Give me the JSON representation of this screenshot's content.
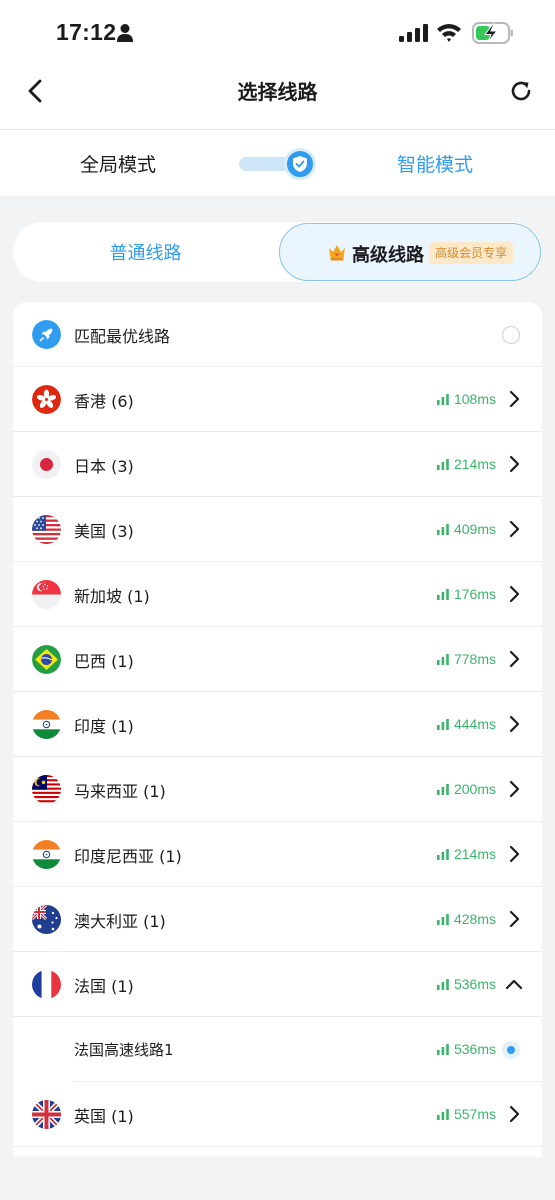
{
  "status_bar": {
    "time": "17:12"
  },
  "nav": {
    "title": "选择线路"
  },
  "mode": {
    "global_label": "全局模式",
    "smart_label": "智能模式",
    "selected": "smart"
  },
  "tabs": {
    "normal_label": "普通线路",
    "premium_label": "高级线路",
    "premium_badge": "高级会员专享",
    "selected": "premium"
  },
  "best_match": {
    "label": "匹配最优线路",
    "selected": false
  },
  "servers": [
    {
      "label": "香港 (6)",
      "latency": "108ms",
      "flag": "hk-flag-icon"
    },
    {
      "label": "日本 (3)",
      "latency": "214ms",
      "flag": "jp-flag-icon"
    },
    {
      "label": "美国 (3)",
      "latency": "409ms",
      "flag": "us-flag-icon"
    },
    {
      "label": "新加坡 (1)",
      "latency": "176ms",
      "flag": "sg-flag-icon"
    },
    {
      "label": "巴西 (1)",
      "latency": "778ms",
      "flag": "br-flag-icon"
    },
    {
      "label": "印度 (1)",
      "latency": "444ms",
      "flag": "in-flag-icon"
    },
    {
      "label": "马来西亚 (1)",
      "latency": "200ms",
      "flag": "my-flag-icon"
    },
    {
      "label": "印度尼西亚 (1)",
      "latency": "214ms",
      "flag": "in-flag-icon"
    },
    {
      "label": "澳大利亚 (1)",
      "latency": "428ms",
      "flag": "au-flag-icon"
    },
    {
      "label": "法国 (1)",
      "latency": "536ms",
      "flag": "fr-flag-icon",
      "expanded": true
    },
    {
      "label": "法国高速线路1",
      "latency": "536ms",
      "is_sub_route": true,
      "selected": true
    },
    {
      "label": "英国 (1)",
      "latency": "557ms",
      "flag": "gb-flag-icon"
    }
  ],
  "colors": {
    "accent": "#2f9cf0",
    "latency_good": "#3bb56a",
    "badge_bg": "#fde9c7",
    "badge_text": "#d8892a"
  }
}
